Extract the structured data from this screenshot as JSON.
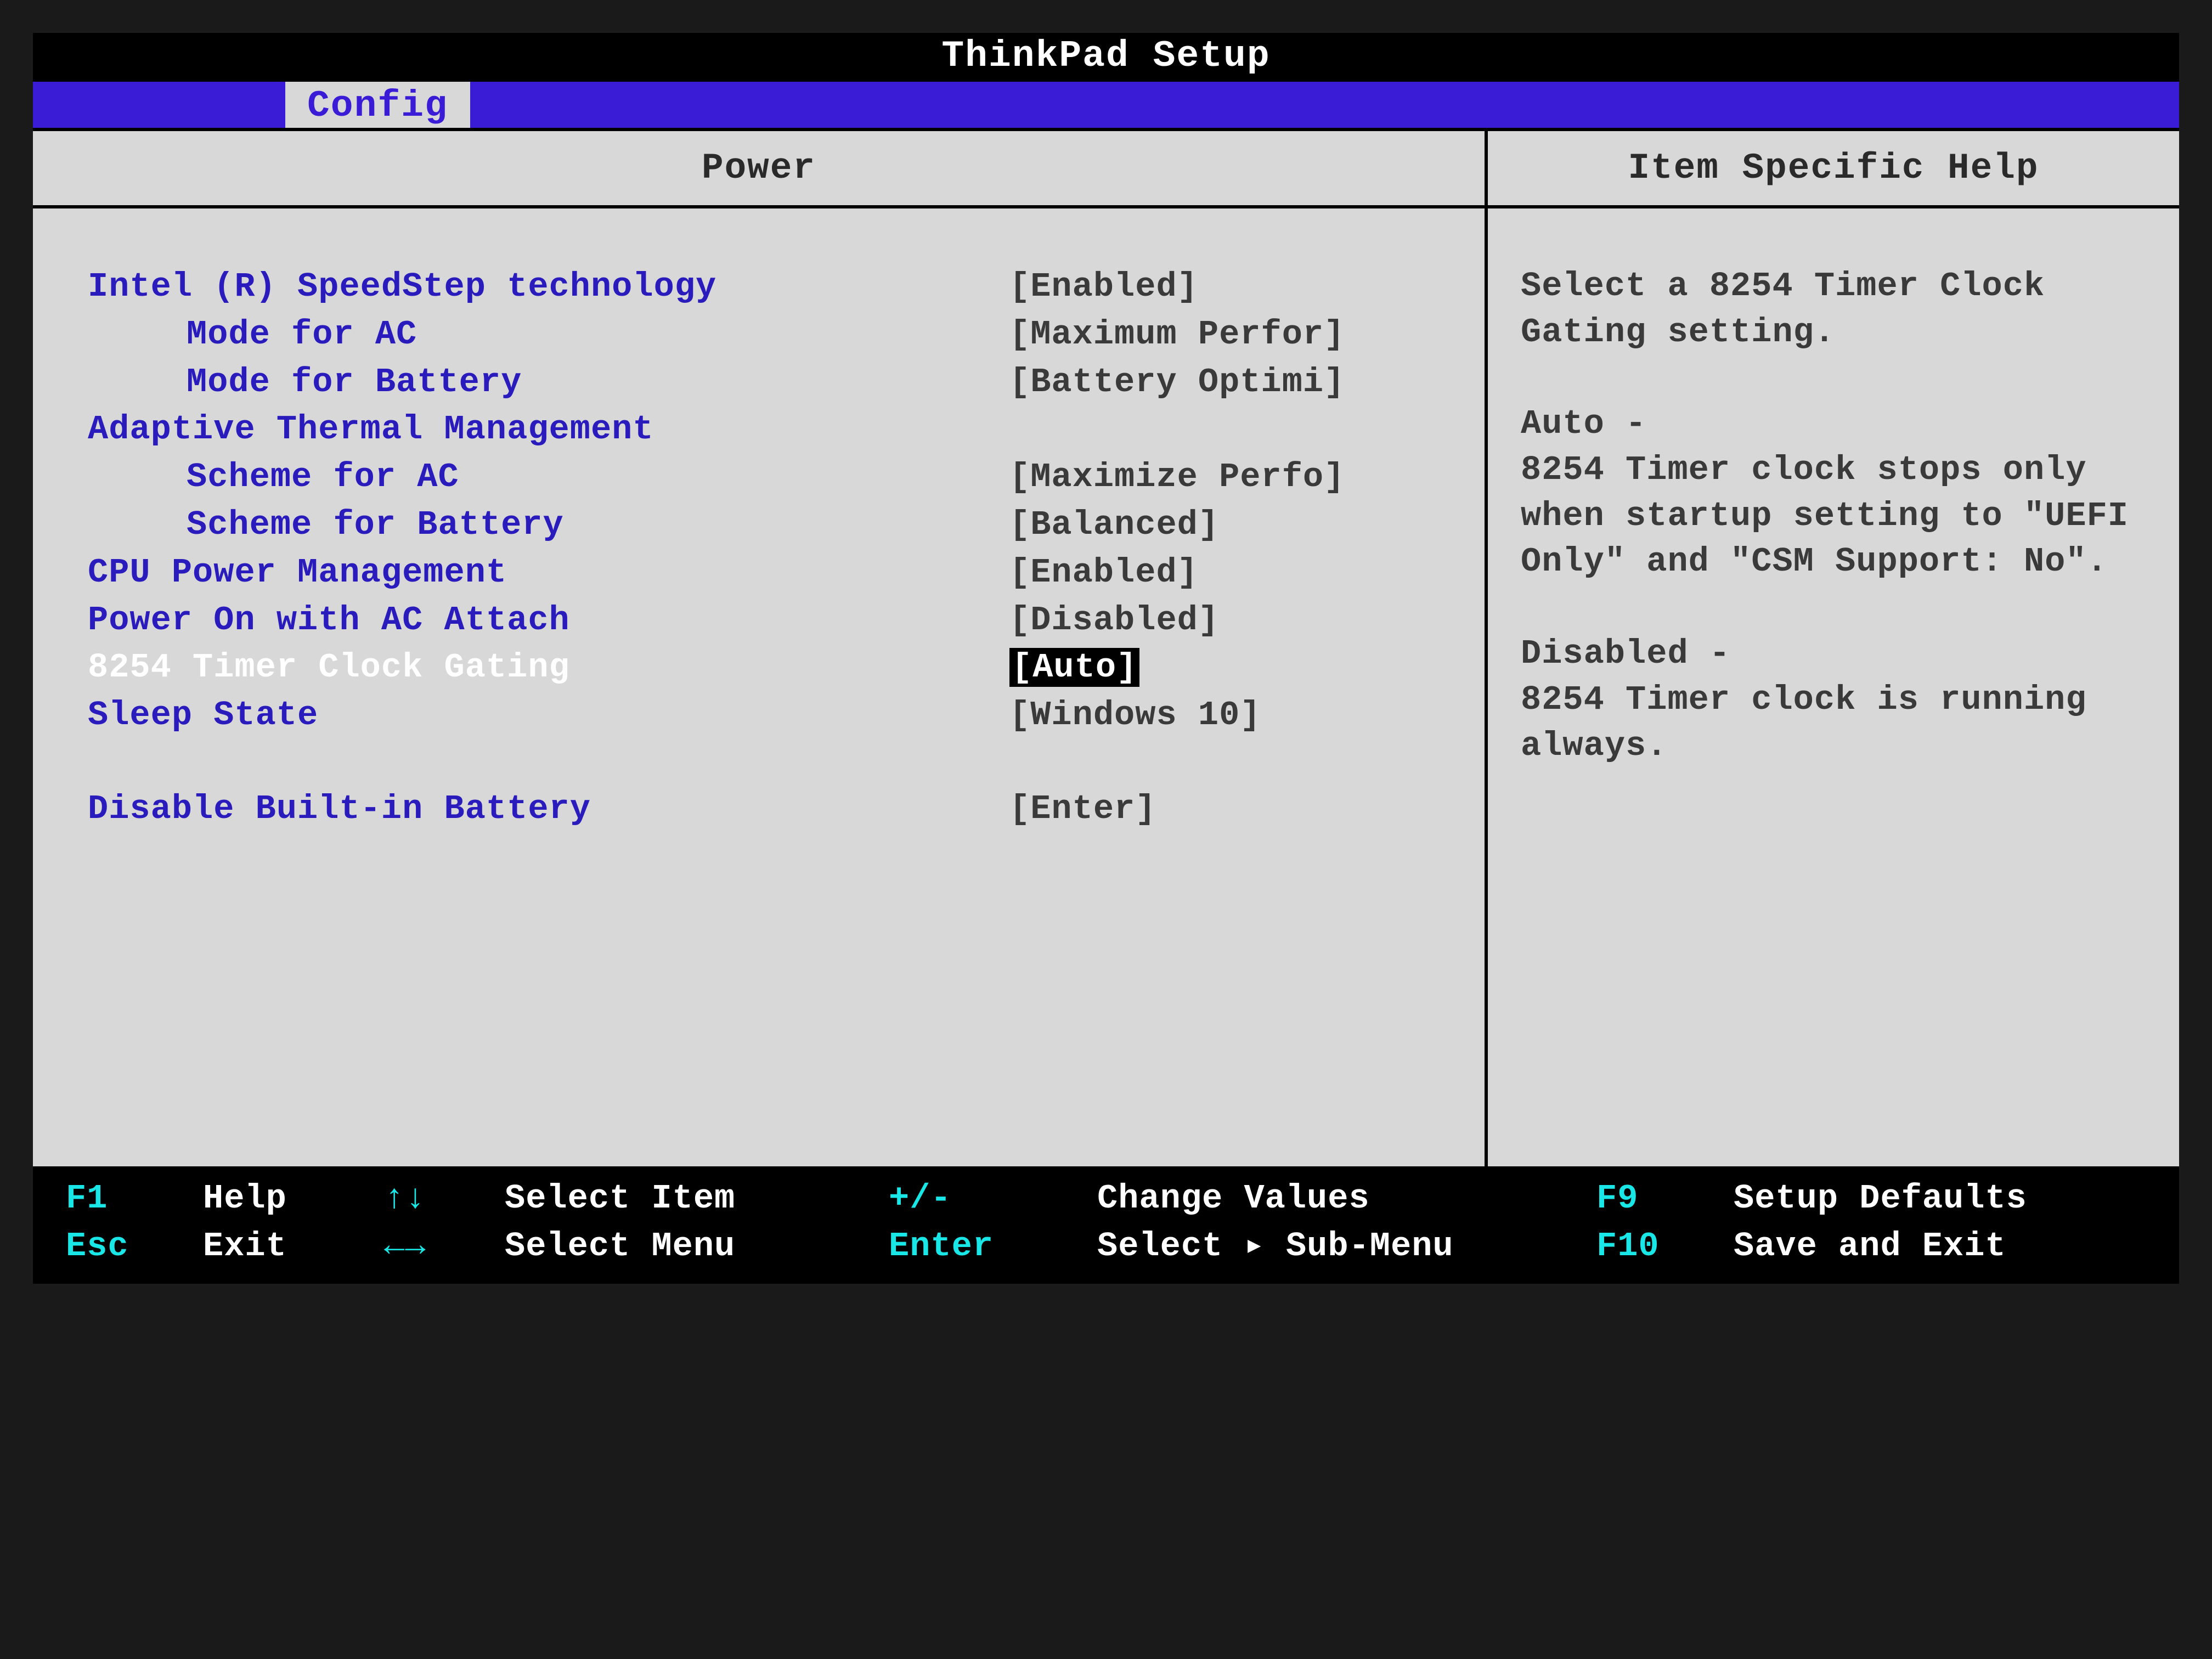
{
  "title": "ThinkPad Setup",
  "tab": "Config",
  "main_header": "Power",
  "help_header": "Item Specific Help",
  "rows": [
    {
      "label": "Intel (R) SpeedStep technology",
      "value": "Enabled",
      "indent": false
    },
    {
      "label": "Mode for AC",
      "value": "Maximum Perfor",
      "indent": true
    },
    {
      "label": "Mode for Battery",
      "value": "Battery Optimi",
      "indent": true
    },
    {
      "label": "Adaptive Thermal Management",
      "value": "",
      "indent": false
    },
    {
      "label": "Scheme for AC",
      "value": "Maximize Perfo",
      "indent": true
    },
    {
      "label": "Scheme for Battery",
      "value": "Balanced",
      "indent": true
    },
    {
      "label": "CPU Power Management",
      "value": "Enabled",
      "indent": false
    },
    {
      "label": "Power On with AC Attach",
      "value": "Disabled",
      "indent": false
    },
    {
      "label": "8254 Timer Clock Gating",
      "value": "Auto",
      "indent": false,
      "selected": true
    },
    {
      "label": "Sleep State",
      "value": "Windows 10",
      "indent": false
    }
  ],
  "action_row": {
    "label": "Disable Built-in Battery",
    "value": "Enter"
  },
  "help": {
    "p1": "Select a 8254 Timer Clock Gating setting.",
    "p2": "Auto -\n8254 Timer clock stops only when startup setting to \"UEFI Only\" and \"CSM Support: No\".",
    "p3": "Disabled -\n8254 Timer clock is running always."
  },
  "footer": {
    "r1": {
      "k1": "F1",
      "t1": "Help",
      "a1": "↑↓",
      "t2": "Select Item",
      "k2": "+/-",
      "t3": "Change Values",
      "k3": "F9",
      "t4": "Setup Defaults"
    },
    "r2": {
      "k1": "Esc",
      "t1": "Exit",
      "a1": "←→",
      "t2": "Select Menu",
      "k2": "Enter",
      "t3": "Select ▸ Sub-Menu",
      "k3": "F10",
      "t4": "Save and Exit"
    }
  }
}
